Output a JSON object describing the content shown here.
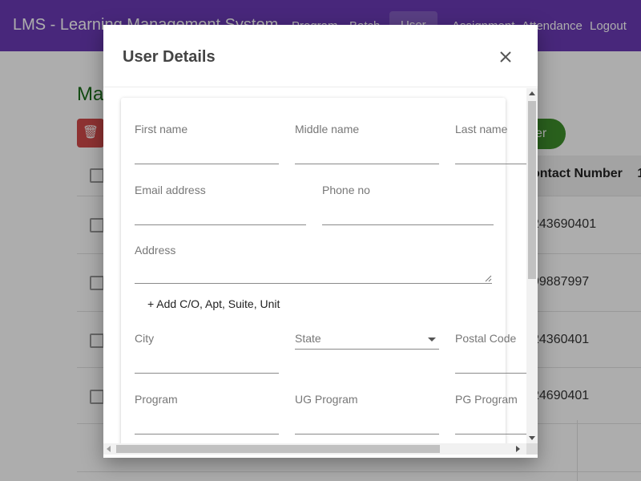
{
  "app": {
    "title": "LMS - Learning Management System",
    "nav": [
      "Program",
      "Batch",
      "User",
      "Assignment",
      "Attendance",
      "Logout"
    ],
    "active_nav": "User"
  },
  "background": {
    "heading": "Ma",
    "add_button_label": "er",
    "column_header": "ontact Number",
    "column_header_overflow": "1",
    "rows": [
      "243690401",
      "99887997",
      "24360401",
      "24690401"
    ]
  },
  "dialog": {
    "title": "User Details",
    "fields": {
      "first_name": {
        "label": "First name",
        "value": ""
      },
      "middle_name": {
        "label": "Middle name",
        "value": ""
      },
      "last_name": {
        "label": "Last name",
        "value": ""
      },
      "email": {
        "label": "Email address",
        "value": ""
      },
      "phone": {
        "label": "Phone no",
        "value": ""
      },
      "address": {
        "label": "Address",
        "value": ""
      },
      "city": {
        "label": "City",
        "value": ""
      },
      "state": {
        "label": "State",
        "value": ""
      },
      "postal_code": {
        "label": "Postal Code",
        "value": ""
      },
      "program": {
        "label": "Program",
        "value": ""
      },
      "ug_program": {
        "label": "UG Program",
        "value": ""
      },
      "pg_program": {
        "label": "PG Program",
        "value": ""
      }
    },
    "add_address_line": "+ Add C/O, Apt, Suite, Unit"
  },
  "colors": {
    "nav_bg": "#6a3ab5",
    "heading_green": "#1b6e1b",
    "delete_red": "#d24b4b",
    "add_green": "#3f8f2c"
  }
}
